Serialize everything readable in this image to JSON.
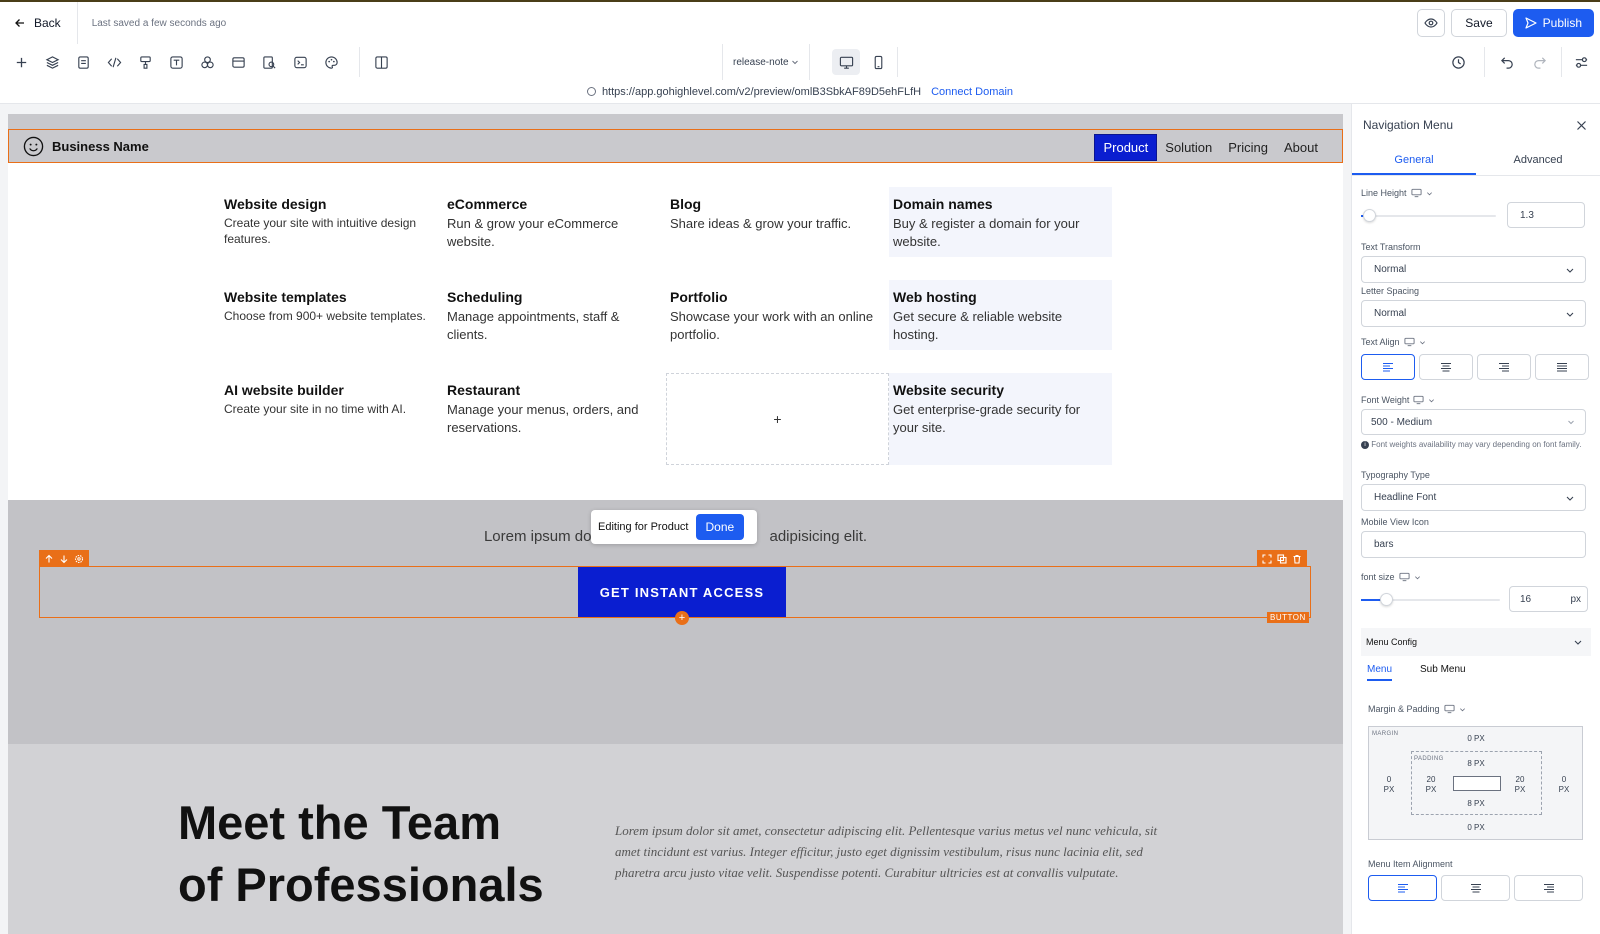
{
  "topbar": {
    "back_label": "Back",
    "saved_text": "Last saved a few seconds ago",
    "save_label": "Save",
    "publish_label": "Publish"
  },
  "toolbar": {
    "page_name": "release-note",
    "tools": [
      "plus-icon",
      "layers-icon",
      "page-icon",
      "code-icon",
      "paint-icon",
      "text-icon",
      "elements-icon",
      "section-icon",
      "search-page-icon",
      "terminal-icon",
      "palette-icon",
      "columns-icon"
    ]
  },
  "urlbar": {
    "url": "https://app.gohighlevel.com/v2/preview/omlB3SbkAF89D5ehFLfH",
    "connect_label": "Connect Domain"
  },
  "site": {
    "brand": "Business Name",
    "nav": [
      "Product",
      "Solution",
      "Pricing",
      "About"
    ],
    "menu_items": [
      {
        "title": "Website design",
        "desc": "Create your site with intuitive design features."
      },
      {
        "title": "eCommerce",
        "desc": "Run & grow your eCommerce website."
      },
      {
        "title": "Blog",
        "desc": "Share ideas & grow your traffic."
      },
      {
        "title": "Domain names",
        "desc": "Buy & register a domain for your website."
      },
      {
        "title": "Website templates",
        "desc": "Choose from 900+ website templates."
      },
      {
        "title": "Scheduling",
        "desc": "Manage appointments, staff & clients."
      },
      {
        "title": "Portfolio",
        "desc": "Showcase your work with an online portfolio."
      },
      {
        "title": "Web hosting",
        "desc": "Get secure & reliable website hosting."
      },
      {
        "title": "AI website builder",
        "desc": "Create your site in no time with AI."
      },
      {
        "title": "Restaurant",
        "desc": "Manage your menus, orders, and reservations."
      },
      {
        "title": "Website security",
        "desc": "Get enterprise-grade security for your site."
      }
    ],
    "add_slot": "+",
    "lorem_left": "Lorem ipsum do",
    "lorem_right": "adipisicing elit.",
    "editing_text": "Editing for Product",
    "done_label": "Done",
    "cta_label": "GET INSTANT ACCESS",
    "button_tag": "BUTTON",
    "add_element": "+",
    "team_title_1": "Meet the Team",
    "team_title_2": "of Professionals",
    "team_text": "Lorem ipsum dolor sit amet, consectetur adipiscing elit. Pellentesque varius metus vel nunc vehicula, sit amet tincidunt est varius. Integer efficitur, justo eget dignissim vestibulum, risus nunc lacinia elit, sed pharetra arcu justo vitae velit. Suspendisse potenti. Curabitur ultricies est at convallis vulputate."
  },
  "panel": {
    "title": "Navigation Menu",
    "tabs": [
      "General",
      "Advanced"
    ],
    "line_height_label": "Line Height",
    "line_height_value": "1.3",
    "line_height_level": 0.06,
    "text_transform_label": "Text Transform",
    "text_transform_value": "Normal",
    "letter_spacing_label": "Letter Spacing",
    "letter_spacing_value": "Normal",
    "text_align_label": "Text Align",
    "font_weight_label": "Font Weight",
    "font_weight_value": "500 - Medium",
    "font_weight_note": "Font weights availability may vary depending on font family.",
    "typography_label": "Typography Type",
    "typography_value": "Headline Font",
    "mobile_icon_label": "Mobile View Icon",
    "mobile_icon_value": "bars",
    "font_size_label": "font size",
    "font_size_value": "16",
    "font_size_unit": "px",
    "font_size_level": 0.18,
    "menu_config_label": "Menu Config",
    "menu_tabs": [
      "Menu",
      "Sub Menu"
    ],
    "margin_padding_label": "Margin & Padding",
    "margin_label": "MARGIN",
    "padding_label": "PADDING",
    "margin_top": "0 PX",
    "margin_bottom": "0 PX",
    "margin_left": "0",
    "margin_right": "0",
    "padding_top": "8 PX",
    "padding_bottom": "8 PX",
    "padding_left": "20",
    "padding_right": "20",
    "unit_px": "PX",
    "menu_item_alignment_label": "Menu Item Alignment"
  },
  "colors": {
    "accent": "#1d5cf0",
    "nav_active": "#0a1ed0",
    "selection": "#e96f18"
  }
}
